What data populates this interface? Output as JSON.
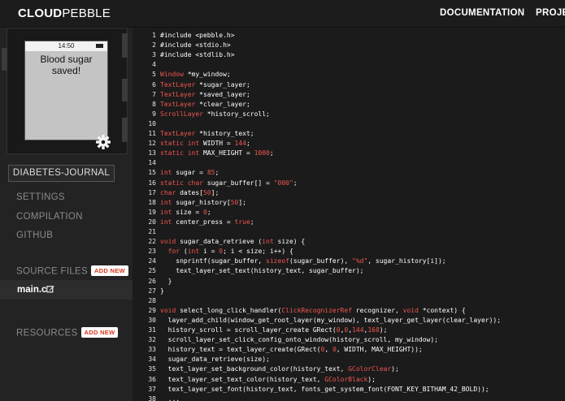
{
  "header": {
    "logo_strong": "CLOUD",
    "logo_light": "PEBBLE",
    "nav": [
      "DOCUMENTATION",
      "PROJE"
    ]
  },
  "emulator": {
    "time": "14:50",
    "message": "Blood sugar saved!"
  },
  "sidebar": {
    "project": "DIABETES-JOURNAL",
    "items": [
      "SETTINGS",
      "COMPILATION",
      "GITHUB"
    ],
    "source_files": "SOURCE FILES",
    "add_new": "ADD NEW",
    "file": "main.c",
    "resources": "RESOURCES"
  },
  "code_lines": [
    [
      [
        "n",
        "#include <pebble.h>"
      ]
    ],
    [
      [
        "n",
        "#include <stdio.h>"
      ]
    ],
    [
      [
        "n",
        "#include <stdlib.h>"
      ]
    ],
    [],
    [
      [
        "k",
        "Window"
      ],
      [
        "n",
        " *my_window;"
      ]
    ],
    [
      [
        "k",
        "TextLayer"
      ],
      [
        "n",
        " *sugar_layer;"
      ]
    ],
    [
      [
        "k",
        "TextLayer"
      ],
      [
        "n",
        " *saved_layer;"
      ]
    ],
    [
      [
        "k",
        "TextLayer"
      ],
      [
        "n",
        " *clear_layer;"
      ]
    ],
    [
      [
        "k",
        "ScrollLayer"
      ],
      [
        "n",
        " *history_scroll;"
      ]
    ],
    [],
    [
      [
        "k",
        "TextLayer"
      ],
      [
        "n",
        " *history_text;"
      ]
    ],
    [
      [
        "k",
        "static int"
      ],
      [
        "n",
        " WIDTH = "
      ],
      [
        "nm",
        "144"
      ],
      [
        "n",
        ";"
      ]
    ],
    [
      [
        "k",
        "static int"
      ],
      [
        "n",
        " MAX_HEIGHT = "
      ],
      [
        "nm",
        "1000"
      ],
      [
        "n",
        ";"
      ]
    ],
    [],
    [
      [
        "k",
        "int"
      ],
      [
        "n",
        " sugar = "
      ],
      [
        "nm",
        "85"
      ],
      [
        "n",
        ";"
      ]
    ],
    [
      [
        "k",
        "static char"
      ],
      [
        "n",
        " sugar_buffer[] = "
      ],
      [
        "s",
        "\"000\""
      ],
      [
        "n",
        ";"
      ]
    ],
    [
      [
        "k",
        "char"
      ],
      [
        "n",
        " dates["
      ],
      [
        "nm",
        "50"
      ],
      [
        "n",
        "];"
      ]
    ],
    [
      [
        "k",
        "int"
      ],
      [
        "n",
        " sugar_history["
      ],
      [
        "nm",
        "50"
      ],
      [
        "n",
        "];"
      ]
    ],
    [
      [
        "k",
        "int"
      ],
      [
        "n",
        " size = "
      ],
      [
        "nm",
        "0"
      ],
      [
        "n",
        ";"
      ]
    ],
    [
      [
        "k",
        "int"
      ],
      [
        "n",
        " center_press = "
      ],
      [
        "k",
        "true"
      ],
      [
        "n",
        ";"
      ]
    ],
    [],
    [
      [
        "k",
        "void"
      ],
      [
        "n",
        " sugar_data_retrieve ("
      ],
      [
        "k",
        "int"
      ],
      [
        "n",
        " size) {"
      ]
    ],
    [
      [
        "n",
        "  "
      ],
      [
        "k",
        "for"
      ],
      [
        "n",
        " ("
      ],
      [
        "k",
        "int"
      ],
      [
        "n",
        " i = "
      ],
      [
        "nm",
        "0"
      ],
      [
        "n",
        "; i < size; i++) {"
      ]
    ],
    [
      [
        "n",
        "    snprintf(sugar_buffer, "
      ],
      [
        "k",
        "sizeof"
      ],
      [
        "n",
        "(sugar_buffer), "
      ],
      [
        "s",
        "\"%d\""
      ],
      [
        "n",
        ", sugar_history[i]);"
      ]
    ],
    [
      [
        "n",
        "    text_layer_set_text(history_text, sugar_buffer);"
      ]
    ],
    [
      [
        "n",
        "  }"
      ]
    ],
    [
      [
        "n",
        "}"
      ]
    ],
    [],
    [
      [
        "k",
        "void"
      ],
      [
        "n",
        " select_long_click_handler("
      ],
      [
        "k",
        "ClickRecognizerRef"
      ],
      [
        "n",
        " recognizer, "
      ],
      [
        "k",
        "void"
      ],
      [
        "n",
        " *context) {"
      ]
    ],
    [
      [
        "n",
        "  layer_add_child(window_get_root_layer(my_window), text_layer_get_layer(clear_layer));"
      ]
    ],
    [
      [
        "n",
        "  history_scroll = scroll_layer_create GRect("
      ],
      [
        "nm",
        "0"
      ],
      [
        "n",
        ","
      ],
      [
        "nm",
        "0"
      ],
      [
        "n",
        ","
      ],
      [
        "nm",
        "144"
      ],
      [
        "n",
        ","
      ],
      [
        "nm",
        "168"
      ],
      [
        "n",
        ");"
      ]
    ],
    [
      [
        "n",
        "  scroll_layer_set_click_config_onto_window(history_scroll, my_window);"
      ]
    ],
    [
      [
        "n",
        "  history_text = text_layer_create(GRect("
      ],
      [
        "nm",
        "0"
      ],
      [
        "n",
        ", "
      ],
      [
        "nm",
        "0"
      ],
      [
        "n",
        ", WIDTH, MAX_HEIGHT));"
      ]
    ],
    [
      [
        "n",
        "  sugar_data_retrieve(size);"
      ]
    ],
    [
      [
        "n",
        "  text_layer_set_background_color(history_text, "
      ],
      [
        "k",
        "GColorClear"
      ],
      [
        "n",
        ");"
      ]
    ],
    [
      [
        "n",
        "  text_layer_set_text_color(history_text, "
      ],
      [
        "k",
        "GColorBlack"
      ],
      [
        "n",
        ");"
      ]
    ],
    [
      [
        "n",
        "  text_layer_set_font(history_text, fonts_get_system_font(FONT_KEY_BITHAM_42_BOLD));"
      ]
    ],
    [
      [
        "n",
        "  ..."
      ]
    ]
  ]
}
